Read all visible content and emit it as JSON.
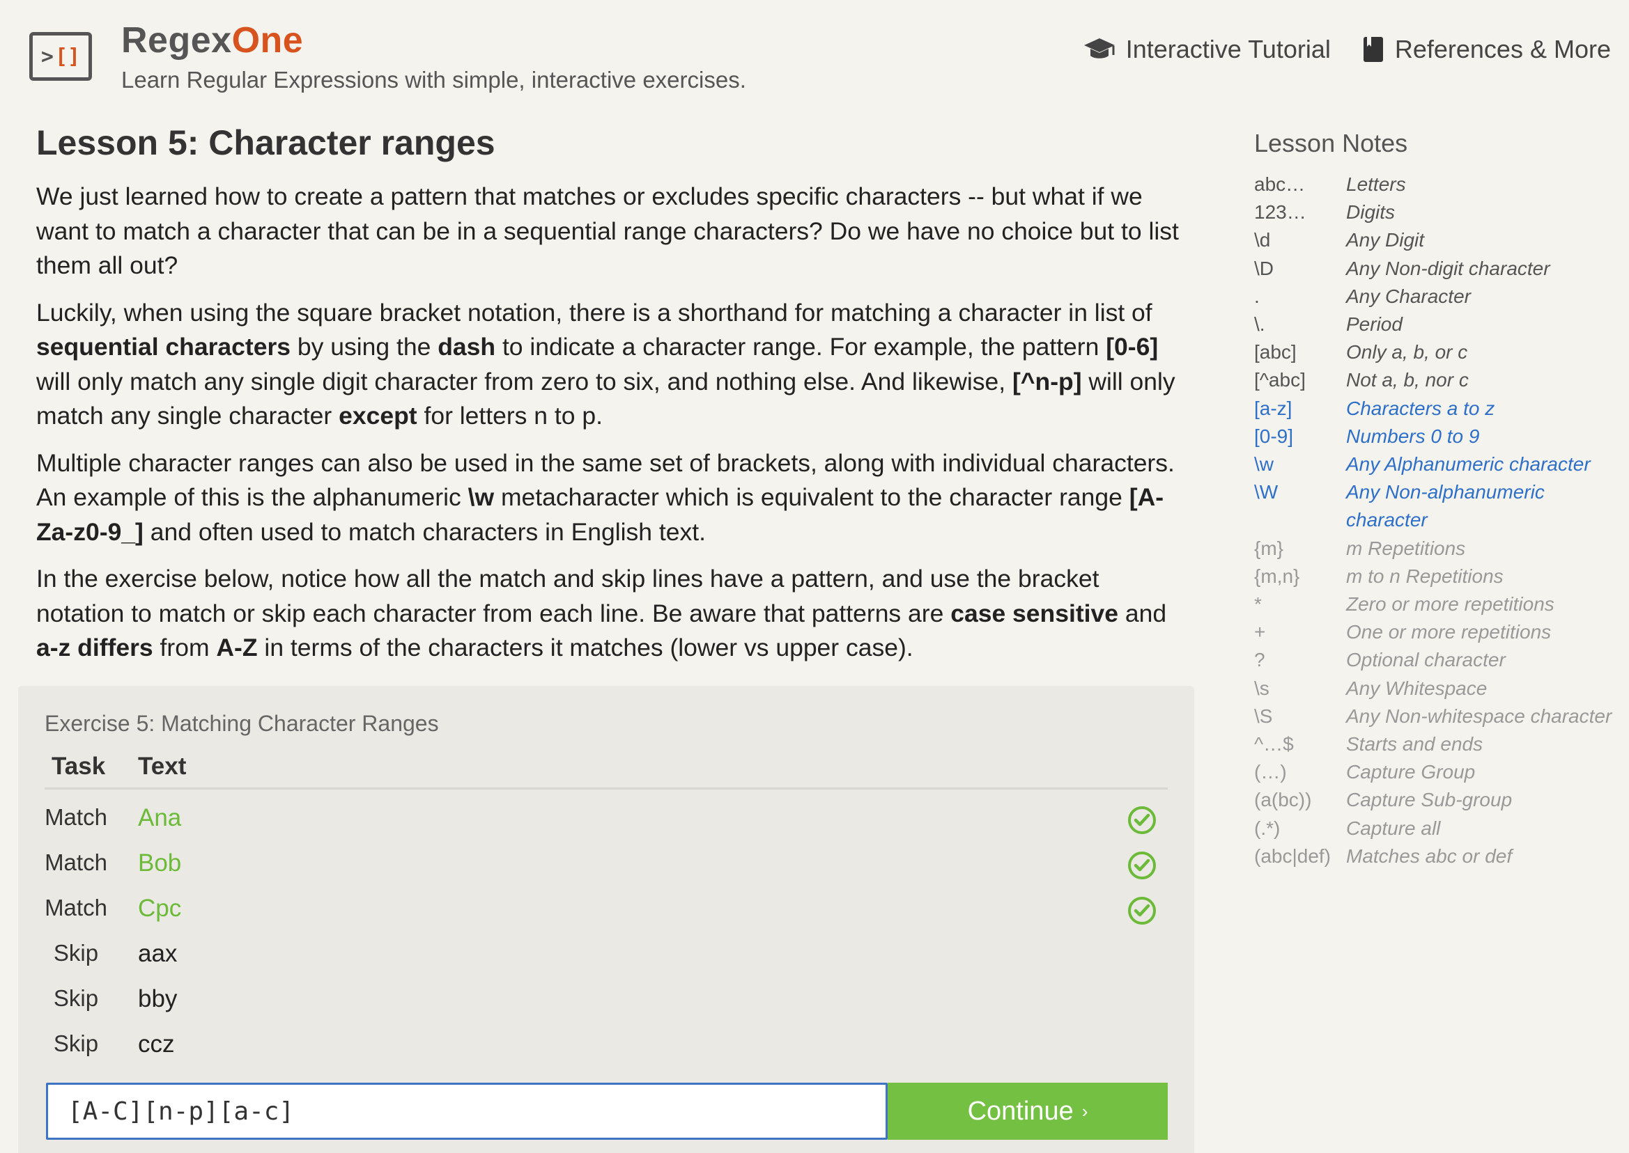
{
  "header": {
    "brand_part1": "Regex",
    "brand_part2": "One",
    "tagline": "Learn Regular Expressions with simple, interactive exercises.",
    "nav": [
      {
        "label": "Interactive Tutorial",
        "icon": "graduation-cap-icon"
      },
      {
        "label": "References & More",
        "icon": "book-icon"
      }
    ]
  },
  "lesson": {
    "title": "Lesson 5: Character ranges",
    "p1": "We just learned how to create a pattern that matches or excludes specific characters -- but what if we want to match a character that can be in a sequential range characters? Do we have no choice but to list them all out?",
    "p2": [
      "Luckily, when using the square bracket notation, there is a shorthand for matching a character in list of ",
      "sequential characters",
      " by using the ",
      "dash",
      " to indicate a character range. For example, the pattern ",
      "[0-6]",
      " will only match any single digit character from zero to six, and nothing else. And likewise, ",
      "[^n-p]",
      " will only match any single character ",
      "except",
      " for letters n to p."
    ],
    "p3": [
      "Multiple character ranges can also be used in the same set of brackets, along with individual characters. An example of this is the alphanumeric ",
      "\\w",
      " metacharacter which is equivalent to the character range ",
      "[A-Za-z0-9_]",
      " and often used to match characters in English text."
    ],
    "p4": [
      "In the exercise below, notice how all the match and skip lines have a pattern, and use the bracket notation to match or skip each character from each line. Be aware that patterns are ",
      "case sensitive",
      " and ",
      "a-z differs",
      " from ",
      "A-Z",
      " in terms of the characters it matches (lower vs upper case)."
    ]
  },
  "exercise": {
    "title": "Exercise 5: Matching Character Ranges",
    "col_task": "Task",
    "col_text": "Text",
    "rows": [
      {
        "task": "Match",
        "text": "Ana",
        "ok": true
      },
      {
        "task": "Match",
        "text": "Bob",
        "ok": true
      },
      {
        "task": "Match",
        "text": "Cpc",
        "ok": true
      },
      {
        "task": "Skip",
        "text": "aax",
        "ok": false
      },
      {
        "task": "Skip",
        "text": "bby",
        "ok": false
      },
      {
        "task": "Skip",
        "text": "ccz",
        "ok": false
      }
    ],
    "input_value": "[A-C][n-p][a-c]",
    "continue_label": "Continue",
    "continue_arrow": "›",
    "colors": {
      "match": "#6cba3a",
      "check": "#6cba3a",
      "input_border": "#3e74c4",
      "button": "#74c043"
    }
  },
  "notes": {
    "title": "Lesson Notes",
    "items": [
      {
        "k": "abc…",
        "v": "Letters",
        "style": "dark"
      },
      {
        "k": "123…",
        "v": "Digits",
        "style": "dark"
      },
      {
        "k": "\\d",
        "v": "Any Digit",
        "style": "dark"
      },
      {
        "k": "\\D",
        "v": "Any Non-digit character",
        "style": "dark"
      },
      {
        "k": ".",
        "v": "Any Character",
        "style": "dark"
      },
      {
        "k": "\\.",
        "v": "Period",
        "style": "dark"
      },
      {
        "k": "[abc]",
        "v": "Only a, b, or c",
        "style": "dark"
      },
      {
        "k": "[^abc]",
        "v": "Not a, b, nor c",
        "style": "dark"
      },
      {
        "k": "[a-z]",
        "v": "Characters a to z",
        "style": "blue"
      },
      {
        "k": "[0-9]",
        "v": "Numbers 0 to 9",
        "style": "blue"
      },
      {
        "k": "\\w",
        "v": "Any Alphanumeric character",
        "style": "blue"
      },
      {
        "k": "\\W",
        "v": "Any Non-alphanumeric character",
        "style": "blue"
      },
      {
        "k": "{m}",
        "v": "m Repetitions",
        "style": "light"
      },
      {
        "k": "{m,n}",
        "v": "m to n Repetitions",
        "style": "light"
      },
      {
        "k": "*",
        "v": "Zero or more repetitions",
        "style": "light"
      },
      {
        "k": "+",
        "v": "One or more repetitions",
        "style": "light"
      },
      {
        "k": "?",
        "v": "Optional character",
        "style": "light"
      },
      {
        "k": "\\s",
        "v": "Any Whitespace",
        "style": "light"
      },
      {
        "k": "\\S",
        "v": "Any Non-whitespace character",
        "style": "light"
      },
      {
        "k": "^…$",
        "v": "Starts and ends",
        "style": "light"
      },
      {
        "k": "(…)",
        "v": "Capture Group",
        "style": "light"
      },
      {
        "k": "(a(bc))",
        "v": "Capture Sub-group",
        "style": "light"
      },
      {
        "k": "(.*)",
        "v": "Capture all",
        "style": "light"
      },
      {
        "k": "(abc|def)",
        "v": "Matches abc or def",
        "style": "light"
      }
    ]
  }
}
